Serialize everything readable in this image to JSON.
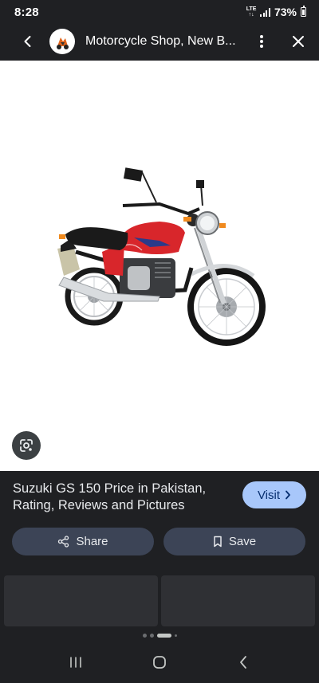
{
  "status_bar": {
    "time": "8:28",
    "network": "LTE",
    "battery_percent": "73%"
  },
  "top_bar": {
    "site_title": "Motorcycle Shop, New B..."
  },
  "result": {
    "title": "Suzuki GS 150 Price in Pakistan, Rating, Reviews and Pictures",
    "visit_label": "Visit",
    "share_label": "Share",
    "save_label": "Save"
  },
  "colors": {
    "background": "#1f2023",
    "visit_button": "#a8c7fa",
    "action_button": "#3c4456",
    "bike_red": "#d8262b"
  },
  "icons": [
    "back-arrow-icon",
    "site-logo-icon",
    "more-vert-icon",
    "close-icon",
    "google-lens-icon",
    "chevron-right-icon",
    "share-icon",
    "bookmark-icon",
    "recents-icon",
    "home-icon",
    "back-icon"
  ]
}
